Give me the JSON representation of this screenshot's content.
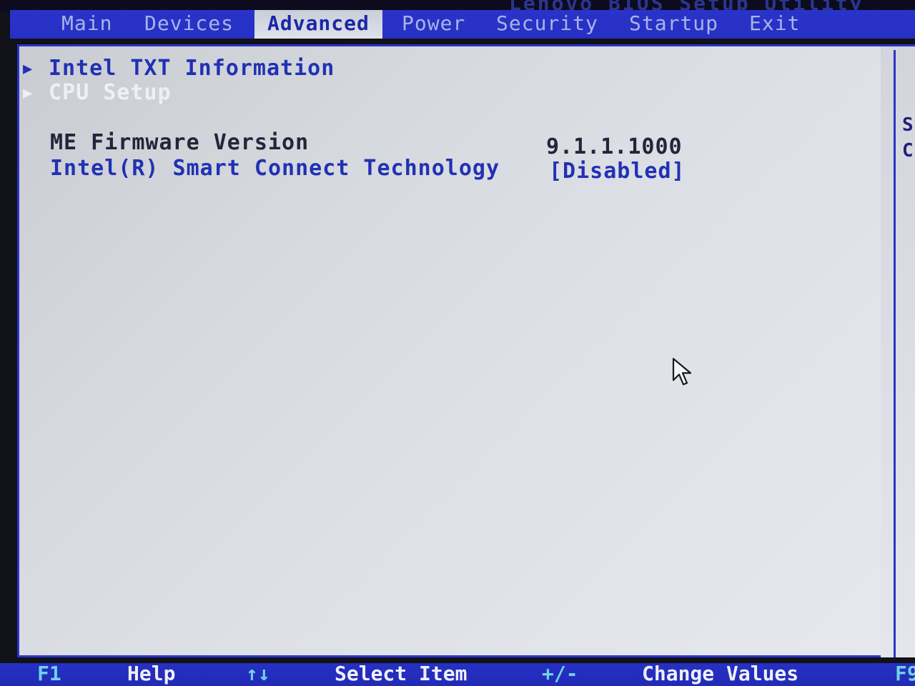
{
  "bios_title": "Lenovo BIOS Setup Utility",
  "menu": {
    "tabs": [
      {
        "label": "Main"
      },
      {
        "label": "Devices"
      },
      {
        "label": "Advanced"
      },
      {
        "label": "Power"
      },
      {
        "label": "Security"
      },
      {
        "label": "Startup"
      },
      {
        "label": "Exit"
      }
    ],
    "active_tab": "Advanced"
  },
  "items": [
    {
      "label": "Intel TXT Information",
      "type": "submenu"
    },
    {
      "label": "CPU Setup",
      "type": "submenu",
      "selected": true
    },
    {
      "label": "ME Firmware Version",
      "value": "9.1.1.1000",
      "type": "info"
    },
    {
      "label": "Intel(R) Smart Connect Technology",
      "value": "[Disabled]",
      "type": "setting"
    }
  ],
  "help_panel": {
    "line1": "S",
    "line2": "C"
  },
  "keybar": [
    {
      "key": "F1",
      "desc": "Help"
    },
    {
      "key": "↑↓",
      "desc": "Select Item"
    },
    {
      "key": "+/-",
      "desc": "Change Values"
    },
    {
      "key": "F9",
      "desc": ""
    }
  ],
  "colors": {
    "menubar": "#2630c4",
    "panel_bg": "#d8dbe0",
    "highlight_text": "#2131b4",
    "key_text": "#6fd2e6"
  },
  "icons": {
    "submenu": "triangle-right-icon",
    "cursor": "mouse-pointer-icon"
  }
}
